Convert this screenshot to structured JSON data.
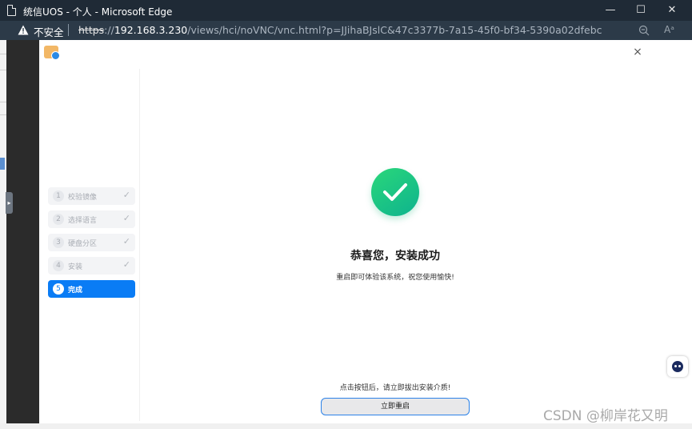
{
  "browser": {
    "window_title": "统信UOS - 个人 - Microsoft Edge",
    "minimize_symbol": "—",
    "maximize_symbol": "☐",
    "close_symbol": "✕",
    "security_label": "不安全",
    "url_scheme": "https",
    "url_sep": "://",
    "url_host": "192.168.3.230",
    "url_path": "/views/hci/noVNC/vnc.html?p=JJihaBJslC&47c3377b-7a15-45f0-bf34-5390a02dfebc",
    "read_aloud_icon": "Aᵃ"
  },
  "installer": {
    "close_symbol": "×",
    "steps": [
      {
        "num": "1",
        "label": "校验镜像",
        "status": "done"
      },
      {
        "num": "2",
        "label": "选择语言",
        "status": "done"
      },
      {
        "num": "3",
        "label": "硬盘分区",
        "status": "done"
      },
      {
        "num": "4",
        "label": "安装",
        "status": "done"
      },
      {
        "num": "5",
        "label": "完成",
        "status": "active"
      }
    ],
    "check_symbol": "✓",
    "heading": "恭喜您，安装成功",
    "subtext": "重启即可体验该系统，祝您使用愉快!",
    "hint": "点击按钮后，请立即拔出安装介质!",
    "reboot_button": "立即重启"
  },
  "watermark": "CSDN @柳岸花又明",
  "colors": {
    "accent": "#0a7cf5",
    "success": "#1fc687",
    "titlebar": "#1f2a36"
  }
}
